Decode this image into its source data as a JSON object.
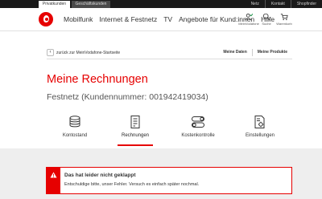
{
  "topbar": {
    "segments": [
      "Privatkunden",
      "Geschäftskunden"
    ],
    "links": [
      "Netz",
      "Kontakt",
      "Shopfinder"
    ]
  },
  "nav": {
    "links": [
      "Mobilfunk",
      "Internet & Festnetz",
      "TV",
      "Angebote für Kund:innen",
      "Hilfe"
    ],
    "icons": [
      {
        "label": "MeinVodafone",
        "icon": "user-check-icon"
      },
      {
        "label": "Suche",
        "icon": "search-icon"
      },
      {
        "label": "Warenkorb",
        "icon": "cart-icon"
      }
    ]
  },
  "breadcrumb": {
    "back": "zurück zur MeinVodafone-Startseite",
    "tabs": [
      "Meine Daten",
      "Meine Produkte"
    ]
  },
  "page": {
    "title": "Meine Rechnungen",
    "subtitle": "Festnetz (Kundennummer: 001942419034)"
  },
  "functions": [
    {
      "label": "Kontostand",
      "icon": "coins-icon"
    },
    {
      "label": "Rechnungen",
      "icon": "invoice-icon",
      "active": true
    },
    {
      "label": "Kostenkontrolle",
      "icon": "toggles-icon"
    },
    {
      "label": "Einstellungen",
      "icon": "settings-document-icon"
    }
  ],
  "alert": {
    "title": "Das hat leider nicht geklappt",
    "message": "Entschuldige bitte, unser Fehler. Versuch es einfach später nochmal."
  },
  "colors": {
    "brand": "#e60000",
    "topbar": "#1a1a1a",
    "content_bg": "#eeeeee"
  }
}
